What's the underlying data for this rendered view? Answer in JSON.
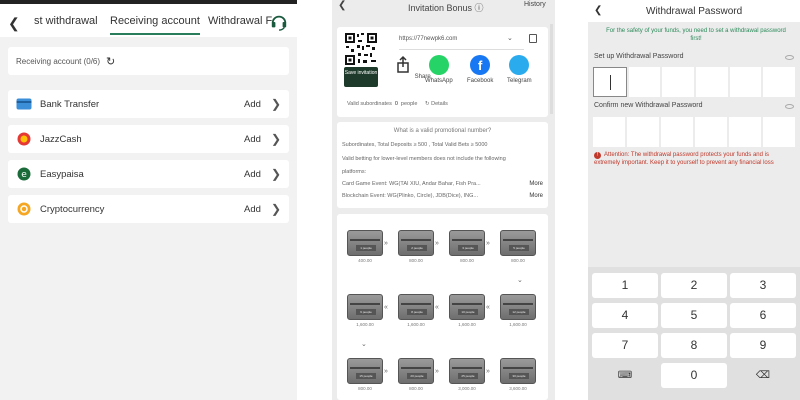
{
  "panel1": {
    "tabs": [
      "st withdrawal",
      "Receiving account",
      "Withdrawal F"
    ],
    "receiving_label": "Receiving account (0/6)",
    "methods": [
      {
        "name": "Bank Transfer",
        "action": "Add",
        "icon": "bank-card-icon"
      },
      {
        "name": "JazzCash",
        "action": "Add",
        "icon": "jazzcash-icon"
      },
      {
        "name": "Easypaisa",
        "action": "Add",
        "icon": "easypaisa-icon"
      },
      {
        "name": "Cryptocurrency",
        "action": "Add",
        "icon": "crypto-icon"
      }
    ],
    "colors": {
      "accent": "#2a7d5b"
    }
  },
  "panel2": {
    "title": "Invitation Bonus",
    "history": "History",
    "url": "https://77newpk6.com",
    "save_btn": "Save invitation",
    "shares": [
      "Share",
      "WhatsApp",
      "Facebook",
      "Telegram"
    ],
    "valid_label": "Valid subordinates",
    "valid_count": "0",
    "valid_unit": "people",
    "details": "Details",
    "question": "What is a valid promotional number?",
    "rule1": "Subordinates, Total Deposits ≥ 500 , Total Valid Bets ≥ 5000",
    "rule2": "Valid betting for lower-level members does not include the following",
    "rule3": "platforms:",
    "card_label": "Card Game Event:",
    "card_value": "WG(TAI XIU, Andar Bahar, Fish Pra...",
    "block_label": "Blockchain Event:",
    "block_value": "WG(Plinko, Circle), JDB(Dice), ING...",
    "more": "More",
    "chests": [
      {
        "people": "1 people",
        "amount": "400.00"
      },
      {
        "people": "2 people",
        "amount": "800.00"
      },
      {
        "people": "3 people",
        "amount": "800.00"
      },
      {
        "people": "5 people",
        "amount": "800.00"
      },
      {
        "people": "12 people",
        "amount": "1,600.00"
      },
      {
        "people": "10 people",
        "amount": "1,600.00"
      },
      {
        "people": "8 people",
        "amount": "1,600.00"
      },
      {
        "people": "6 people",
        "amount": "1,600.00"
      },
      {
        "people": "15 people",
        "amount": "800.00"
      },
      {
        "people": "20 people",
        "amount": "800.00"
      },
      {
        "people": "25 people",
        "amount": "3,000.00"
      },
      {
        "people": "30 people",
        "amount": "3,600.00"
      }
    ]
  },
  "panel3": {
    "title": "Withdrawal Password",
    "safety": "For the safety of your funds, you need to set a withdrawal password first!",
    "setup_label": "Set up Withdrawal Password",
    "confirm_label": "Confirm new Withdrawal Password",
    "warning": "Attention: The withdrawal password protects your funds and is extremely important. Keep it to yourself to prevent any financial loss",
    "keys": [
      "1",
      "2",
      "3",
      "4",
      "5",
      "6",
      "7",
      "8",
      "9",
      "",
      "0",
      ""
    ]
  }
}
